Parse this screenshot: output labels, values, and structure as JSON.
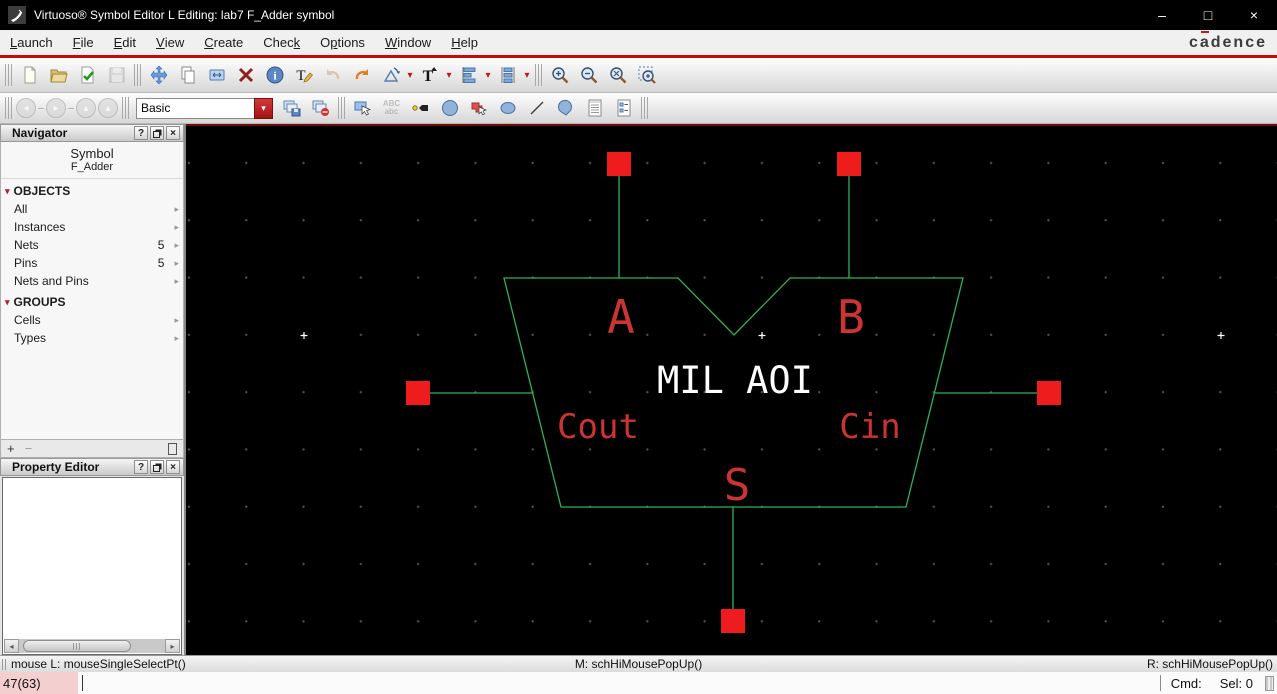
{
  "window": {
    "title": "Virtuoso® Symbol Editor L Editing: lab7 F_Adder symbol",
    "minimize": "–",
    "maximize": "□",
    "close": "×"
  },
  "menubar": {
    "items": [
      {
        "pre": "",
        "u": "L",
        "post": "aunch"
      },
      {
        "pre": "",
        "u": "F",
        "post": "ile"
      },
      {
        "pre": "",
        "u": "E",
        "post": "dit"
      },
      {
        "pre": "",
        "u": "V",
        "post": "iew"
      },
      {
        "pre": "",
        "u": "C",
        "post": "reate"
      },
      {
        "pre": "Chec",
        "u": "k",
        "post": ""
      },
      {
        "pre": "O",
        "u": "p",
        "post": "tions"
      },
      {
        "pre": "",
        "u": "W",
        "post": "indow"
      },
      {
        "pre": "",
        "u": "H",
        "post": "elp"
      }
    ],
    "brand": {
      "pre": "c",
      "a": "a",
      "post": "dence"
    }
  },
  "icons": {
    "back": "◂",
    "forward": "▸",
    "up": "▴",
    "top": "▴",
    "dropdown": "▾",
    "combo_drop": "▾",
    "dash": "–",
    "tree_expand": "▾",
    "tree_item": "▸",
    "help": "?",
    "close": "×",
    "info_glyph": "i",
    "text_glyph": "T",
    "edit_label_glyph": "T",
    "abc_top": "ABC",
    "abc_bottom": "abc",
    "scroll_left": "◂",
    "scroll_right": "▸",
    "add": "+",
    "remove": "−"
  },
  "toolbar2": {
    "layer_combo_value": "Basic"
  },
  "navigator": {
    "title": "Navigator",
    "view_type": "Symbol",
    "cell_name": "F_Adder",
    "objects_header": "OBJECTS",
    "objects": [
      {
        "label": "All",
        "count": ""
      },
      {
        "label": "Instances",
        "count": ""
      },
      {
        "label": "Nets",
        "count": "5"
      },
      {
        "label": "Pins",
        "count": "5"
      },
      {
        "label": "Nets and Pins",
        "count": ""
      }
    ],
    "groups_header": "GROUPS",
    "groups": [
      {
        "label": "Cells"
      },
      {
        "label": "Types"
      }
    ]
  },
  "property_editor": {
    "title": "Property Editor"
  },
  "canvas": {
    "center_label": "MIL AOI",
    "pin_labels": {
      "a": "A",
      "b": "B",
      "cout": "Cout",
      "cin": "Cin",
      "s": "S"
    },
    "colors": {
      "outline_green": "#2eb257",
      "pin_red": "#ee1c1c",
      "label_red": "#cc3333",
      "center_text": "#ffffff",
      "grid_dot": "#4f4f4f",
      "origin_cross": "#ffffff",
      "accent_dark_red": "#6e0b0b"
    }
  },
  "statusbar": {
    "left": "mouse L: mouseSingleSelectPt()",
    "middle": "M: schHiMousePopUp()",
    "right": "R: schHiMousePopUp()"
  },
  "bottombar": {
    "bindkey": "47(63)",
    "cmd": "Cmd:",
    "sel": "Sel: 0"
  }
}
